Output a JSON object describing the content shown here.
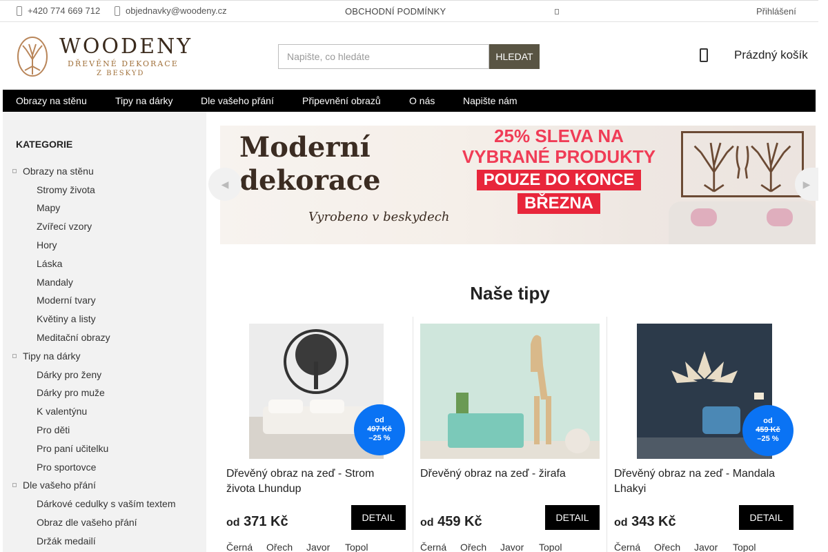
{
  "topbar": {
    "phone": "+420 774 669 712",
    "email": "objednavky@woodeny.cz",
    "terms": "OBCHODNÍ PODMÍNKY",
    "login": "Přihlášení"
  },
  "header": {
    "brand": "WOODENY",
    "tagline1": "DŘEVĚNÉ DEKORACE",
    "tagline2": "Z BESKYD",
    "search_placeholder": "Napište, co hledáte",
    "search_button": "HLEDAT",
    "cart_label": "Prázdný košík"
  },
  "nav": [
    "Obrazy na stěnu",
    "Tipy na dárky",
    "Dle vašeho přání",
    "Připevnění obrazů",
    "O nás",
    "Napište nám"
  ],
  "sidebar": {
    "title": "KATEGORIE",
    "categories": [
      {
        "label": "Obrazy na stěnu",
        "level": 0
      },
      {
        "label": "Stromy života",
        "level": 1
      },
      {
        "label": "Mapy",
        "level": 1
      },
      {
        "label": "Zvířecí vzory",
        "level": 1
      },
      {
        "label": "Hory",
        "level": 1
      },
      {
        "label": "Láska",
        "level": 1
      },
      {
        "label": "Mandaly",
        "level": 1
      },
      {
        "label": "Moderní tvary",
        "level": 1
      },
      {
        "label": "Květiny a listy",
        "level": 1
      },
      {
        "label": "Meditační obrazy",
        "level": 1
      },
      {
        "label": "Tipy na dárky",
        "level": 0
      },
      {
        "label": "Dárky pro ženy",
        "level": 1
      },
      {
        "label": "Dárky pro muže",
        "level": 1
      },
      {
        "label": "K valentýnu",
        "level": 1
      },
      {
        "label": "Pro děti",
        "level": 1
      },
      {
        "label": "Pro paní učitelku",
        "level": 1
      },
      {
        "label": "Pro sportovce",
        "level": 1
      },
      {
        "label": "Dle vašeho přání",
        "level": 0
      },
      {
        "label": "Dárkové cedulky s vaším textem",
        "level": 1
      },
      {
        "label": "Obraz dle vašeho přání",
        "level": 1
      },
      {
        "label": "Držák medailí",
        "level": 1
      }
    ]
  },
  "banner": {
    "headline1": "Moderní",
    "headline2": "dekorace",
    "script": "Vyrobeno v beskydech",
    "promo1": "25% SLEVA NA",
    "promo2": "VYBRANÉ PRODUKTY",
    "promo3": "POUZE DO KONCE",
    "promo4": "BŘEZNA"
  },
  "tips": {
    "title": "Naše tipy",
    "detail_label": "DETAIL",
    "price_prefix": "od",
    "products": [
      {
        "name": "Dřevěný obraz na zeď - Strom života Lhundup",
        "price": "371 Kč",
        "badge": {
          "prefix": "od",
          "old_price": "497 Kč",
          "discount": "–25 %"
        },
        "variants": [
          "Černá",
          "Ořech",
          "Javor",
          "Topol"
        ]
      },
      {
        "name": "Dřevěný obraz na zeď - žirafa",
        "price": "459 Kč",
        "badge": null,
        "variants": [
          "Černá",
          "Ořech",
          "Javor",
          "Topol"
        ]
      },
      {
        "name": "Dřevěný obraz na zeď - Mandala Lhakyi",
        "price": "343 Kč",
        "badge": {
          "prefix": "od",
          "old_price": "459 Kč",
          "discount": "–25 %"
        },
        "variants": [
          "Černá",
          "Ořech",
          "Javor",
          "Topol"
        ]
      }
    ]
  },
  "colors": {
    "search_button": "#595443",
    "nav_bg": "#000000",
    "sidebar_bg": "#f2f2f2",
    "badge": "#0a73f4",
    "promo": "#e8263b"
  }
}
